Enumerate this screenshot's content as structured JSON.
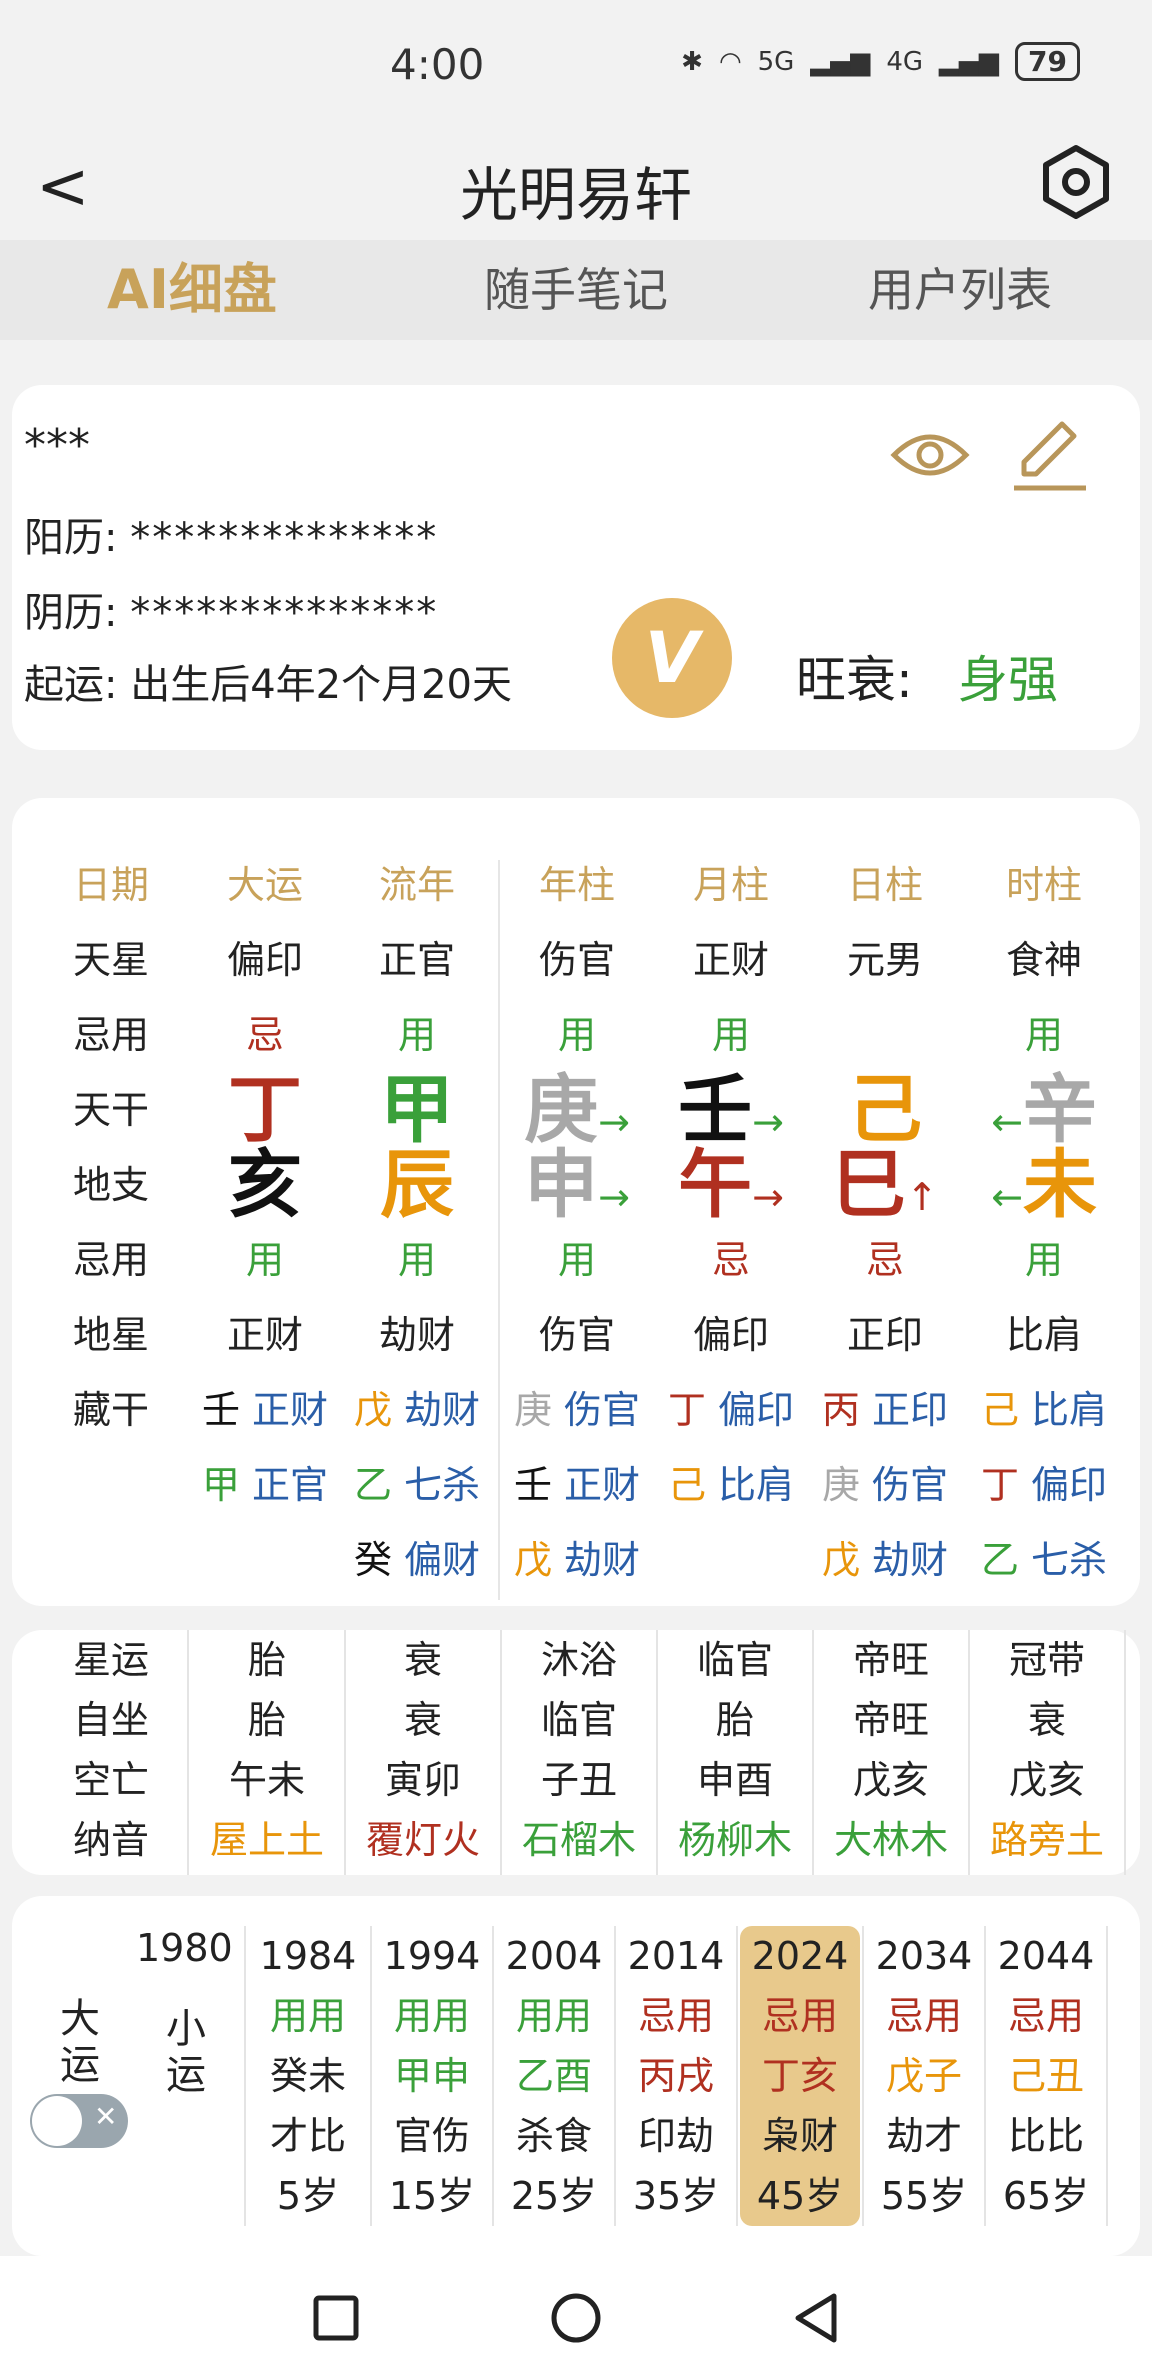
{
  "status": {
    "time": "4:00",
    "battery": "79",
    "net1": "5G",
    "net2": "4G"
  },
  "header": {
    "title": "光明易轩"
  },
  "tabs": [
    "AI细盘",
    "随手笔记",
    "用户列表"
  ],
  "profile": {
    "name": "***",
    "solar_label": "阳历:",
    "solar_value": "**************",
    "lunar_label": "阴历:",
    "lunar_value": "**************",
    "qiyun_label": "起运:",
    "qiyun_value": "出生后4年2个月20天",
    "wangshuai_label": "旺衰:",
    "wangshuai_value": "身强"
  },
  "pillars": {
    "row_labels": [
      "日期",
      "天星",
      "忌用",
      "天干",
      "地支",
      "忌用",
      "地星",
      "藏干"
    ],
    "columns": [
      {
        "header": "大运",
        "tianxing": "偏印",
        "jy1": "忌",
        "gan": "丁",
        "zhi": "亥",
        "jy2": "用",
        "dixing": "正财",
        "cang": [
          {
            "g": "壬",
            "s": "正财"
          },
          {
            "g": "甲",
            "s": "正官"
          }
        ]
      },
      {
        "header": "流年",
        "tianxing": "正官",
        "jy1": "用",
        "gan": "甲",
        "zhi": "辰",
        "jy2": "用",
        "dixing": "劫财",
        "cang": [
          {
            "g": "戊",
            "s": "劫财"
          },
          {
            "g": "乙",
            "s": "七杀"
          },
          {
            "g": "癸",
            "s": "偏财"
          }
        ]
      },
      {
        "header": "年柱",
        "tianxing": "伤官",
        "jy1": "用",
        "gan": "庚",
        "zhi": "申",
        "jy2": "用",
        "dixing": "伤官",
        "cang": [
          {
            "g": "庚",
            "s": "伤官"
          },
          {
            "g": "壬",
            "s": "正财"
          },
          {
            "g": "戊",
            "s": "劫财"
          }
        ]
      },
      {
        "header": "月柱",
        "tianxing": "正财",
        "jy1": "用",
        "gan": "壬",
        "zhi": "午",
        "jy2": "忌",
        "dixing": "偏印",
        "cang": [
          {
            "g": "丁",
            "s": "偏印"
          },
          {
            "g": "己",
            "s": "比肩"
          }
        ]
      },
      {
        "header": "日柱",
        "tianxing": "元男",
        "jy1": "",
        "gan": "己",
        "zhi": "巳",
        "jy2": "忌",
        "dixing": "正印",
        "cang": [
          {
            "g": "丙",
            "s": "正印"
          },
          {
            "g": "庚",
            "s": "伤官"
          },
          {
            "g": "戊",
            "s": "劫财"
          }
        ]
      },
      {
        "header": "时柱",
        "tianxing": "食神",
        "jy1": "用",
        "gan": "辛",
        "zhi": "未",
        "jy2": "用",
        "dixing": "比肩",
        "cang": [
          {
            "g": "己",
            "s": "比肩"
          },
          {
            "g": "丁",
            "s": "偏印"
          },
          {
            "g": "乙",
            "s": "七杀"
          }
        ]
      }
    ]
  },
  "stars": {
    "labels": [
      "星运",
      "自坐",
      "空亡",
      "纳音"
    ],
    "columns": [
      {
        "xingyun": "胎",
        "zizuo": "胎",
        "kongwang": "午未",
        "nayin": "屋上土"
      },
      {
        "xingyun": "衰",
        "zizuo": "衰",
        "kongwang": "寅卯",
        "nayin": "覆灯火"
      },
      {
        "xingyun": "沐浴",
        "zizuo": "临官",
        "kongwang": "子丑",
        "nayin": "石榴木"
      },
      {
        "xingyun": "临官",
        "zizuo": "胎",
        "kongwang": "申酉",
        "nayin": "杨柳木"
      },
      {
        "xingyun": "帝旺",
        "zizuo": "帝旺",
        "kongwang": "戊亥",
        "nayin": "大林木"
      },
      {
        "xingyun": "冠带",
        "zizuo": "衰",
        "kongwang": "戊亥",
        "nayin": "路旁土"
      }
    ]
  },
  "dayun": {
    "label1": "大运",
    "label2": "小运",
    "start_year": "1980",
    "items": [
      {
        "year": "1984",
        "jy": "用用",
        "gz": "癸未",
        "ss": "才比",
        "age": "5岁"
      },
      {
        "year": "1994",
        "jy": "用用",
        "gz": "甲申",
        "ss": "官伤",
        "age": "15岁"
      },
      {
        "year": "2004",
        "jy": "用用",
        "gz": "乙酉",
        "ss": "杀食",
        "age": "25岁"
      },
      {
        "year": "2014",
        "jy": "忌用",
        "gz": "丙戌",
        "ss": "印劫",
        "age": "35岁"
      },
      {
        "year": "2024",
        "jy": "忌用",
        "gz": "丁亥",
        "ss": "枭财",
        "age": "45岁"
      },
      {
        "year": "2034",
        "jy": "忌用",
        "gz": "戊子",
        "ss": "劫才",
        "age": "55岁"
      },
      {
        "year": "2044",
        "jy": "忌用",
        "gz": "己丑",
        "ss": "比比",
        "age": "65岁"
      }
    ]
  },
  "colors": {
    "accent_gold": "#c8a25a",
    "use_green": "#3aa03a",
    "avoid_red": "#b03020",
    "earth_orange": "#e8950a",
    "god_blue": "#2a5ea8"
  },
  "icons": [
    "back-chevron-icon",
    "settings-hexagon-icon",
    "eye-icon",
    "edit-pencil-icon",
    "vip-badge-icon",
    "square-nav-icon",
    "circle-nav-icon",
    "triangle-back-nav-icon"
  ]
}
